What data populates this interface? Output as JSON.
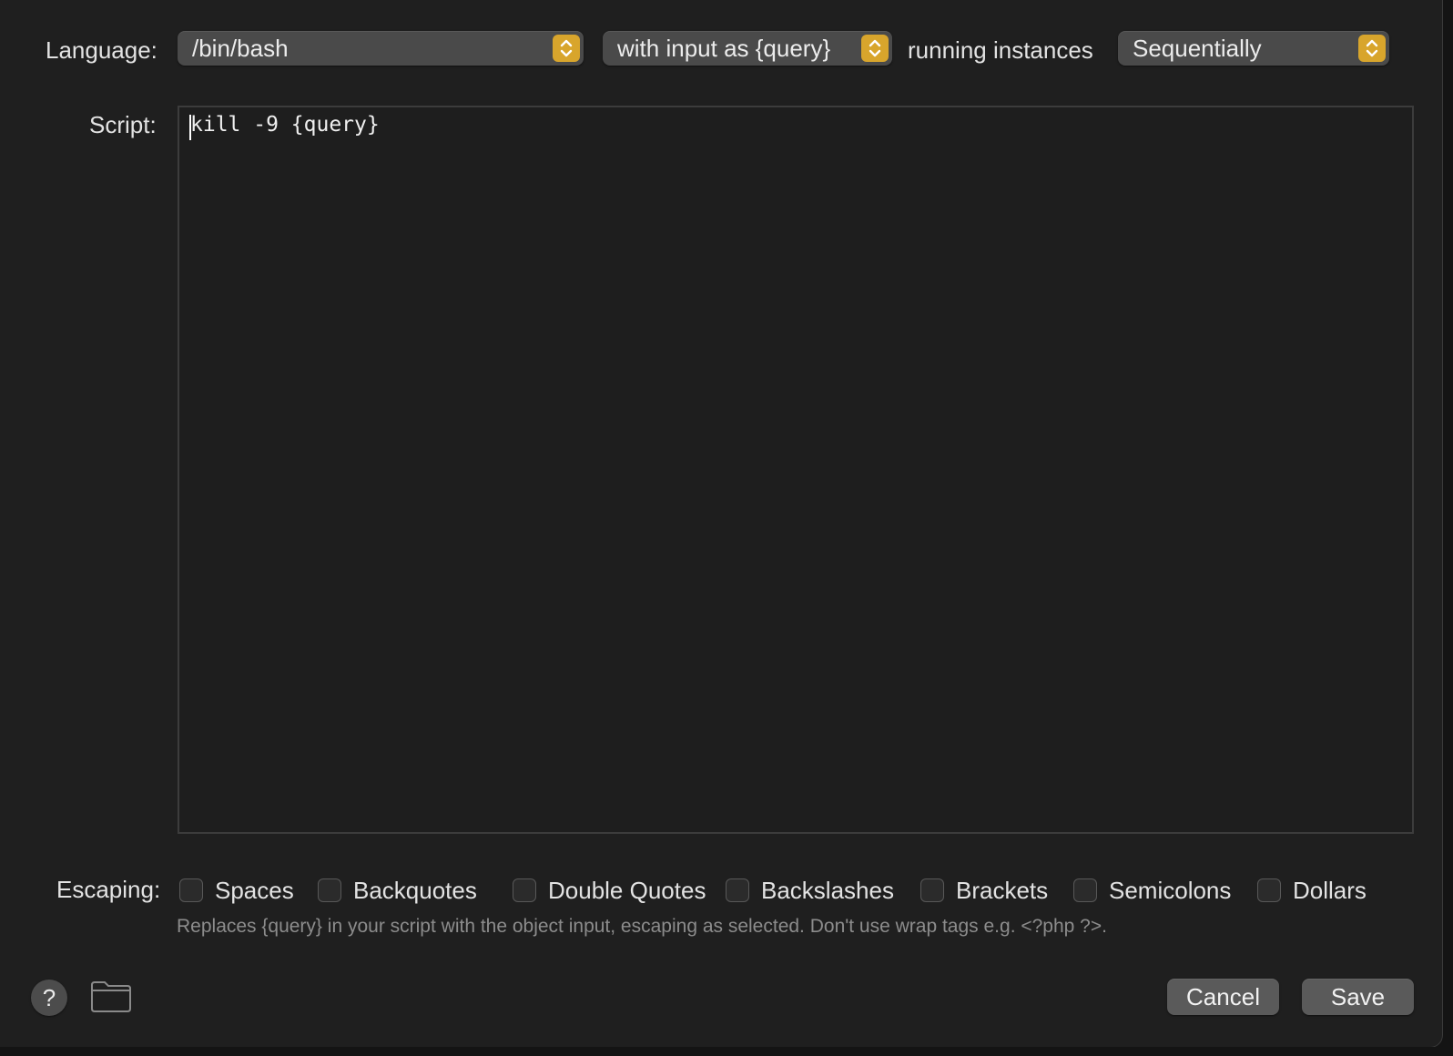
{
  "header": {
    "language_label": "Language:",
    "language_value": "/bin/bash",
    "input_mode_value": "with input as {query}",
    "running_instances_label": "running instances",
    "instances_value": "Sequentially"
  },
  "script": {
    "label": "Script:",
    "code": "kill -9 {query}"
  },
  "escaping": {
    "label": "Escaping:",
    "options": [
      {
        "label": "Spaces",
        "checked": false
      },
      {
        "label": "Backquotes",
        "checked": false
      },
      {
        "label": "Double Quotes",
        "checked": false
      },
      {
        "label": "Backslashes",
        "checked": false
      },
      {
        "label": "Brackets",
        "checked": false
      },
      {
        "label": "Semicolons",
        "checked": false
      },
      {
        "label": "Dollars",
        "checked": false
      }
    ],
    "hint": "Replaces {query} in your script with the object input, escaping as selected. Don't use wrap tags e.g. <?php ?>."
  },
  "footer": {
    "help_glyph": "?",
    "help_icon": "question-mark-icon",
    "folder_icon": "folder-icon",
    "cancel_label": "Cancel",
    "save_label": "Save"
  },
  "colors": {
    "accent": "#d8a52c",
    "background": "#1f1f1f"
  }
}
